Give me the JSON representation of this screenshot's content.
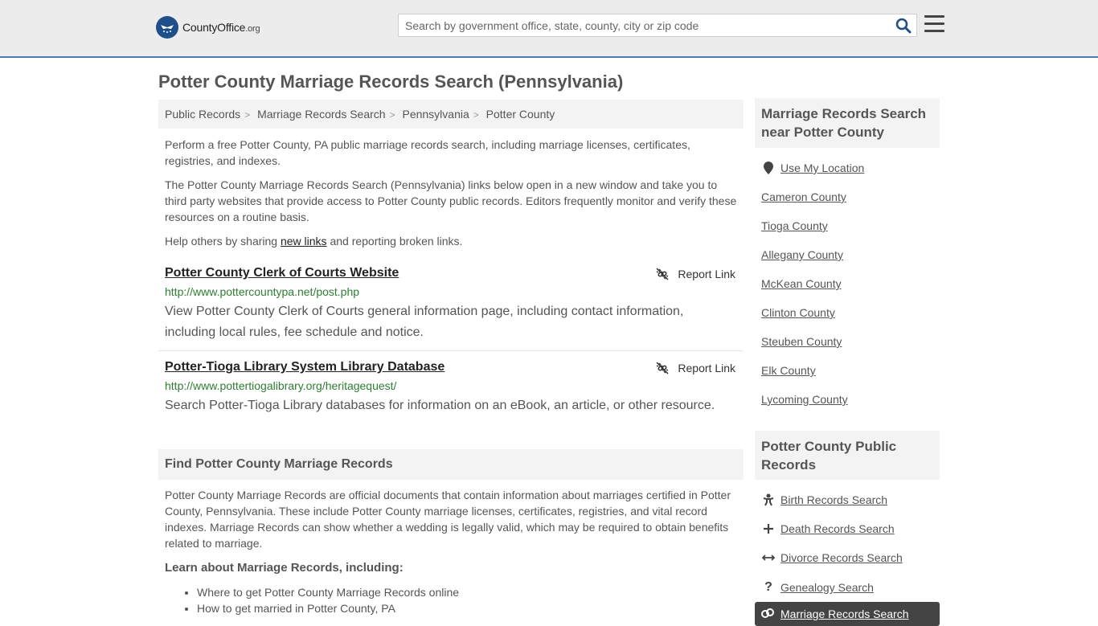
{
  "header": {
    "logo_main": "CountyOffice",
    "logo_tld": ".org",
    "search_placeholder": "Search by government office, state, county, city or zip code"
  },
  "page": {
    "title": "Potter County Marriage Records Search (Pennsylvania)"
  },
  "breadcrumb": [
    "Public Records",
    "Marriage Records Search",
    "Pennsylvania",
    "Potter County"
  ],
  "intro": {
    "p1": "Perform a free Potter County, PA public marriage records search, including marriage licenses, certificates, registries, and indexes.",
    "p2": "The Potter County Marriage Records Search (Pennsylvania) links below open in a new window and take you to third party websites that provide access to Potter County public records. Editors frequently monitor and verify these resources on a routine basis.",
    "p3_before": "Help others by sharing ",
    "p3_link": "new links",
    "p3_after": " and reporting broken links."
  },
  "links": [
    {
      "title": "Potter County Clerk of Courts Website",
      "url": "http://www.pottercountypa.net/post.php",
      "description": "View Potter County Clerk of Courts general information page, including contact information, including local rules, fee schedule and notice.",
      "report_label": "Report Link"
    },
    {
      "title": "Potter-Tioga Library System Library Database",
      "url": "http://www.pottertiogalibrary.org/heritagequest/",
      "description": "Search Potter-Tioga Library databases for information on an eBook, an article, or other resource.",
      "report_label": "Report Link"
    }
  ],
  "find_section": {
    "header": "Find Potter County Marriage Records",
    "paragraph": "Potter County Marriage Records are official documents that contain information about marriages certified in Potter County, Pennsylvania. These include Potter County marriage licenses, certificates, registries, and vital record indexes. Marriage Records can show whether a wedding is legally valid, which may be required to obtain benefits related to marriage.",
    "learn_title": "Learn about Marriage Records, including:",
    "learn_items": [
      "Where to get Potter County Marriage Records online",
      "How to get married in Potter County, PA"
    ]
  },
  "sidebar": {
    "nearby_title": "Marriage Records Search near Potter County",
    "use_location": "Use My Location",
    "nearby": [
      "Cameron County",
      "Tioga County",
      "Allegany County",
      "McKean County",
      "Clinton County",
      "Steuben County",
      "Elk County",
      "Lycoming County"
    ],
    "public_title": "Potter County Public Records",
    "public_items": [
      {
        "label": "Birth Records Search",
        "icon": "baby-icon"
      },
      {
        "label": "Death Records Search",
        "icon": "cross-icon"
      },
      {
        "label": "Divorce Records Search",
        "icon": "split-arrows-icon"
      },
      {
        "label": "Genealogy Search",
        "icon": "question-icon"
      }
    ],
    "active_item": "Marriage Records Search"
  }
}
